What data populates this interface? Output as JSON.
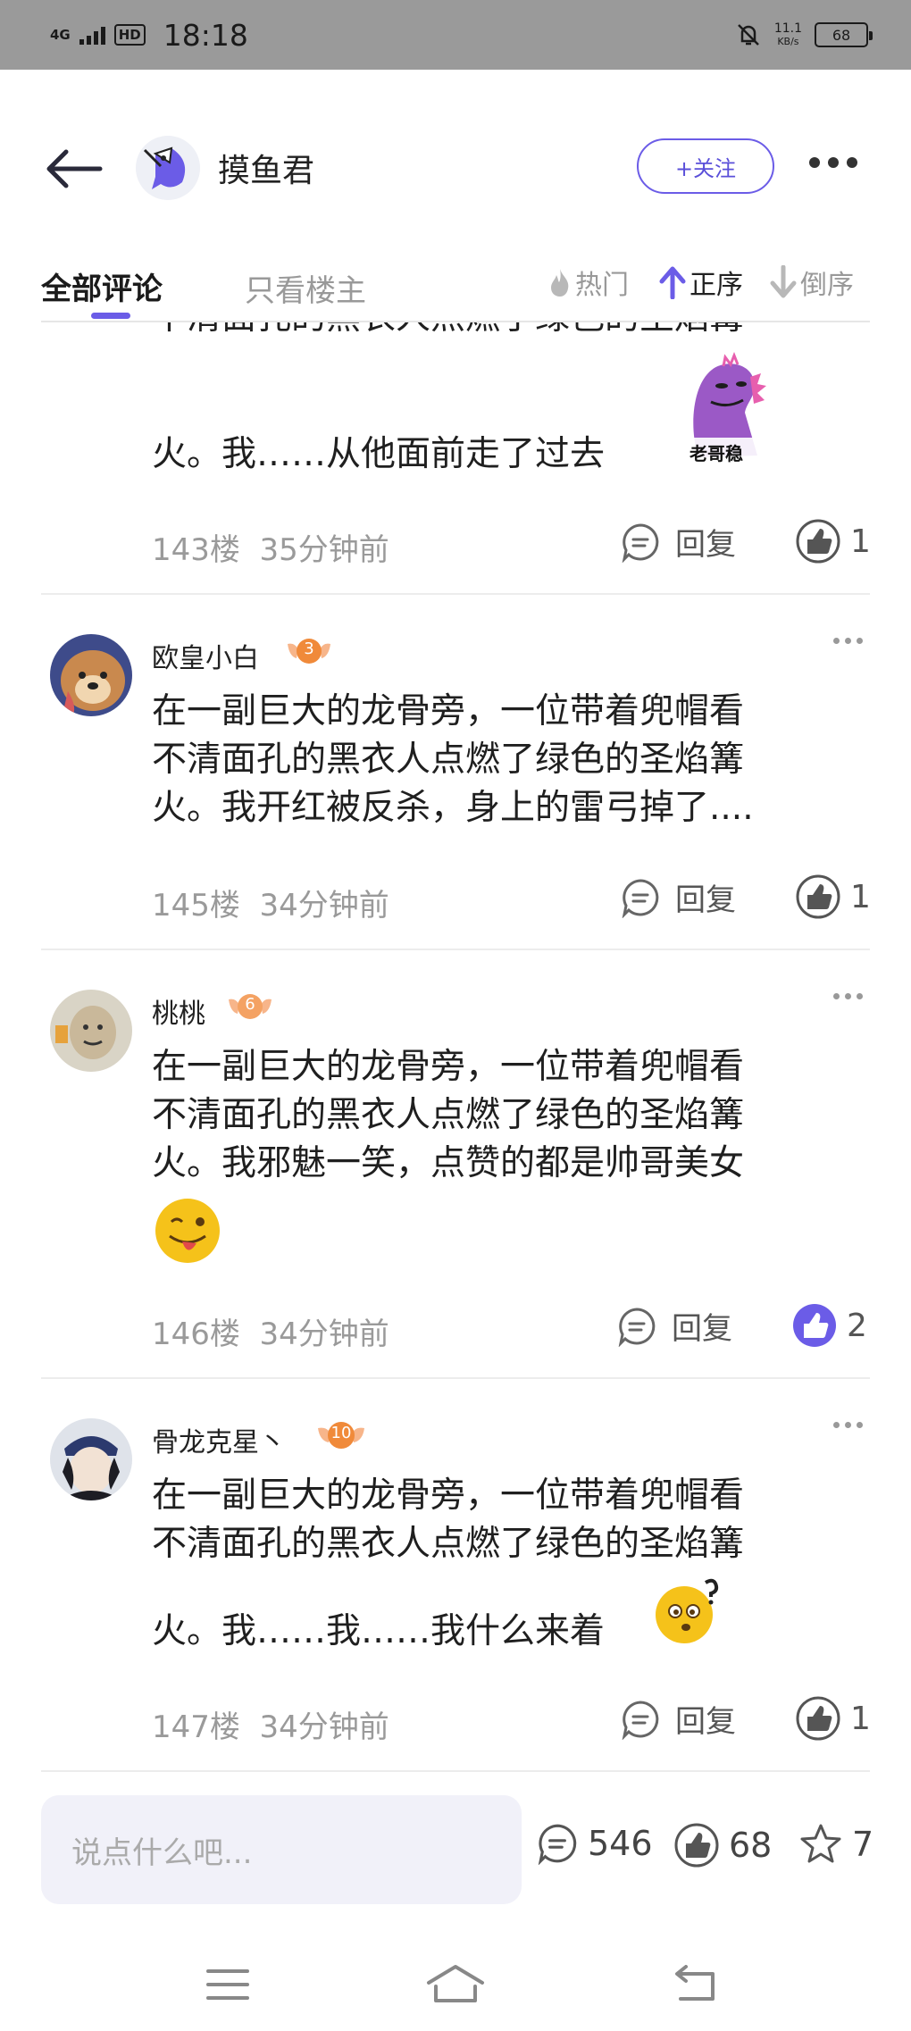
{
  "status_bar": {
    "network": "4G",
    "hd": "HD",
    "time": "18:18",
    "speed_value": "11.1",
    "speed_unit": "KB/s",
    "battery": "68"
  },
  "header": {
    "title": "摸鱼君",
    "follow_label": "+关注"
  },
  "tabs": {
    "all": "全部评论",
    "op_only": "只看楼主",
    "hot": "热门",
    "asc": "正序",
    "desc": "倒序"
  },
  "comments": [
    {
      "partial": true,
      "text_lines": [
        "不清面孔的黑衣人点燃了绿色的圣焰篝",
        "火。我……从他面前走了过去"
      ],
      "sticker_caption": "老哥稳",
      "floor": "143楼",
      "time": "35分钟前",
      "reply_label": "回复",
      "likes": "1"
    },
    {
      "username": "欧皇小白",
      "level": "3",
      "text_lines": [
        "在一副巨大的龙骨旁，一位带着兜帽看",
        "不清面孔的黑衣人点燃了绿色的圣焰篝",
        "火。我开红被反杀，身上的雷弓掉了...."
      ],
      "floor": "145楼",
      "time": "34分钟前",
      "reply_label": "回复",
      "likes": "1"
    },
    {
      "username": "桃桃",
      "level": "6",
      "text_lines": [
        "在一副巨大的龙骨旁，一位带着兜帽看",
        "不清面孔的黑衣人点燃了绿色的圣焰篝",
        "火。我邪魅一笑，点赞的都是帅哥美女"
      ],
      "floor": "146楼",
      "time": "34分钟前",
      "reply_label": "回复",
      "likes": "2"
    },
    {
      "username": "骨龙克星丶",
      "level": "10",
      "text_lines": [
        "在一副巨大的龙骨旁，一位带着兜帽看",
        "不清面孔的黑衣人点燃了绿色的圣焰篝",
        "火。我……我……我什么来着"
      ],
      "floor": "147楼",
      "time": "34分钟前",
      "reply_label": "回复",
      "likes": "1"
    }
  ],
  "bottom": {
    "input_placeholder": "说点什么吧...",
    "comment_count": "546",
    "like_count": "68",
    "star_count": "7"
  },
  "colors": {
    "accent": "#6b5ce7",
    "status_bar": "#9a9a9a"
  }
}
